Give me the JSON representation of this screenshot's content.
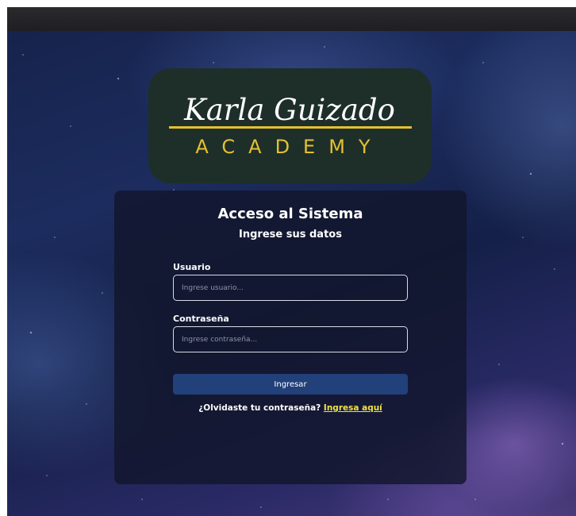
{
  "logo": {
    "script_text": "Karla Guizado",
    "academy_text": "ACADEMY",
    "colors": {
      "background": "#1e2f2a",
      "script": "#ffffff",
      "gold": "#e6c02e"
    }
  },
  "login": {
    "title": "Acceso al Sistema",
    "subtitle": "Ingrese sus datos",
    "username": {
      "label": "Usuario",
      "placeholder": "Ingrese usuario...",
      "value": ""
    },
    "password": {
      "label": "Contraseña",
      "placeholder": "Ingrese contraseña...",
      "value": ""
    },
    "submit_label": "Ingresar",
    "forgot_text": "¿Olvidaste tu contraseña?",
    "forgot_link": "Ingresa aquí"
  },
  "colors": {
    "card_background": "#12162c",
    "button": "#22407a",
    "link": "#f2e43a"
  },
  "background_image": "starry-galaxy-background"
}
